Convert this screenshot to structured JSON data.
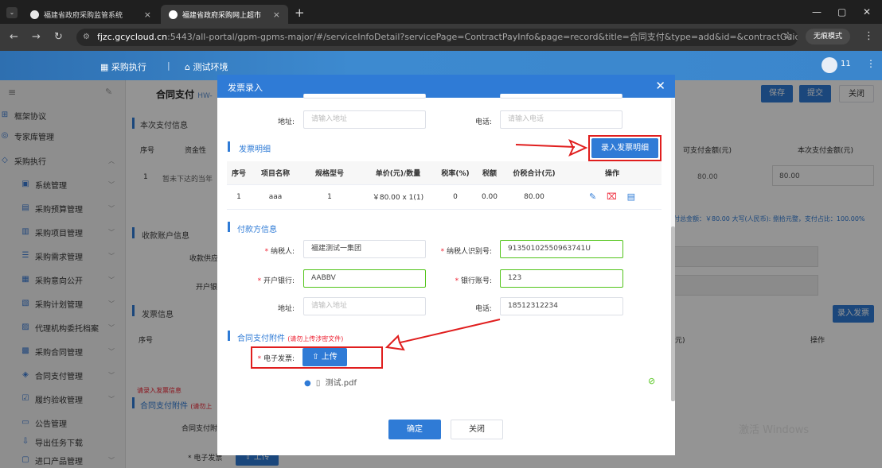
{
  "browser": {
    "tabs": [
      {
        "title": "福建省政府采购监管系统"
      },
      {
        "title": "福建省政府采购网上超市"
      }
    ],
    "url_host": "fjzc.gcycloud.cn",
    "url_path": ":5443/all-portal/gpm-gpms-major/#/serviceInfoDetail?servicePage=ContractPayInfo&page=record&title=合同支付&type=add&id=&contractGuid=&fundId=30...",
    "incognito_label": "无痕模式"
  },
  "header": {
    "nav_execute": "采购执行",
    "nav_env": "测试环境",
    "user_count": "11"
  },
  "sidebar": {
    "items": [
      {
        "label": "框架协议",
        "icon": "grid-icon"
      },
      {
        "label": "专家库管理",
        "icon": "expert-icon"
      },
      {
        "label": "采购执行",
        "icon": "shield-icon"
      },
      {
        "label": "系统管理",
        "icon": "system-icon"
      },
      {
        "label": "采购预算管理",
        "icon": "budget-icon"
      },
      {
        "label": "采购项目管理",
        "icon": "project-icon"
      },
      {
        "label": "采购需求管理",
        "icon": "demand-icon"
      },
      {
        "label": "采购意向公开",
        "icon": "intent-icon"
      },
      {
        "label": "采购计划管理",
        "icon": "plan-icon"
      },
      {
        "label": "代理机构委托档案",
        "icon": "archive-icon"
      },
      {
        "label": "采购合同管理",
        "icon": "contract-icon"
      },
      {
        "label": "合同支付管理",
        "icon": "payment-icon"
      },
      {
        "label": "履约验收管理",
        "icon": "accept-icon"
      },
      {
        "label": "公告管理",
        "icon": "notice-icon"
      },
      {
        "label": "导出任务下载",
        "icon": "download-icon"
      },
      {
        "label": "进口产品管理",
        "icon": "import-icon"
      }
    ]
  },
  "background": {
    "page_title": "合同支付",
    "page_title_sub": "HW-",
    "save": "保存",
    "submit": "提交",
    "close": "关闭",
    "sec_pay_info": "本次支付信息",
    "col_seq": "序号",
    "col_fund": "资金性",
    "row1_seq": "1",
    "row1_text": "暂未下达的当年",
    "col_payable": "可支付金额(元)",
    "col_this_pay": "本次支付金额(元)",
    "payable_value": "80.00",
    "this_pay_value": "80.00",
    "summary": "付总金额：￥80.00 大写(人民币): 捌拾元整，支付占比：100.00%",
    "sec_account": "收款账户信息",
    "acct_supplier": "收款供应",
    "acct_bank": "开户银",
    "sec_invoice": "发票信息",
    "invoice_btn": "录入发票",
    "inv_col_seq": "序号",
    "inv_col_yuan": "元)",
    "inv_col_op": "操作",
    "enter_invoice_hint": "请录入发票信息",
    "sec_attach": "合同支付附件",
    "sec_attach_note": "(请勿上",
    "attach_label": "合同支付附",
    "efp_label": "* 电子发票",
    "efp_btn": "上传",
    "watermark": "激活 Windows"
  },
  "modal": {
    "title": "发票录入",
    "top_address_label": "地址:",
    "top_address_ph": "请输入地址",
    "top_phone_label": "电话:",
    "top_phone_ph": "请输入电话",
    "sec_detail": "发票明细",
    "enter_detail_btn": "录入发票明细",
    "table_headers": [
      "序号",
      "项目名称",
      "规格型号",
      "单价(元)/数量",
      "税率(%)",
      "税额",
      "价税合计(元)",
      "操作"
    ],
    "rows": [
      {
        "seq": "1",
        "name": "aaa",
        "spec": "1",
        "price_qty": "￥80.00 x 1(1)",
        "rate": "0",
        "tax": "0.00",
        "total": "80.00"
      }
    ],
    "sec_payer": "付款方信息",
    "taxpayer_label": "纳税人:",
    "taxpayer_value": "福建测试一集团",
    "taxid_label": "纳税人识别号:",
    "taxid_value": "91350102550963741U",
    "bank_label": "开户银行:",
    "bank_value": "AABBV",
    "account_label": "银行账号:",
    "account_value": "123",
    "address_label": "地址:",
    "address_ph": "请输入地址",
    "phone_label": "电话:",
    "phone_value": "18512312234",
    "sec_attach": "合同支付附件",
    "sec_attach_note": "(请勿上传涉密文件)",
    "efp_label": "电子发票:",
    "upload_btn": "上传",
    "file_name": "测试.pdf",
    "confirm": "确定",
    "close": "关闭"
  },
  "colors": {
    "primary": "#2f7bd6",
    "annotation_red": "#e01e1e",
    "success_green": "#52c41a"
  }
}
